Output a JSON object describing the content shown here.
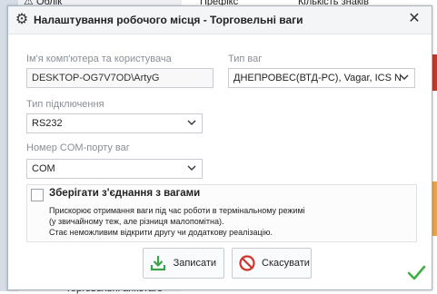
{
  "background": {
    "left_tree_item": "Облік",
    "center_header": "Префікс",
    "right_header": "Кількість знаків",
    "bottom_item": "Торговельні анкетаге"
  },
  "dialog": {
    "title": "Налаштування робочого місця - Торговельні ваги",
    "close_label": "✕",
    "computer_user": {
      "label": "Ім'я комп'ютера та користувача",
      "value": "DESKTOP-OG7V7OD\\ArtyG"
    },
    "scale_type": {
      "label": "Тип ваг",
      "value": "ДНЕПРОВЕС(ВТД-РС), Vagar, ICS N"
    },
    "connection_type": {
      "label": "Тип підключення",
      "value": "RS232"
    },
    "com_port": {
      "label": "Номер COM-порту ваг",
      "value": "COM"
    },
    "save_connection": {
      "label": "Зберігати з'єднання з вагами",
      "checked": false,
      "note_line1": "Прискорює отримання ваги під час роботи в термінальному режимі",
      "note_line2": "(у звичайному теж, але різниця малопомітна).",
      "note_line3": "Стає неможливим відкрити другу чи додаткову реалізацію."
    },
    "buttons": {
      "save_label": "Записати",
      "cancel_label": "Скасувати"
    },
    "icons": {
      "title_icon": "gear-icon",
      "save_icon": "download-icon",
      "cancel_icon": "cancel-icon",
      "status_icon": "checkmark-icon"
    },
    "colors": {
      "save_icon": "#3aa34a",
      "cancel_icon": "#d0342c",
      "checkmark": "#3cb043"
    }
  }
}
